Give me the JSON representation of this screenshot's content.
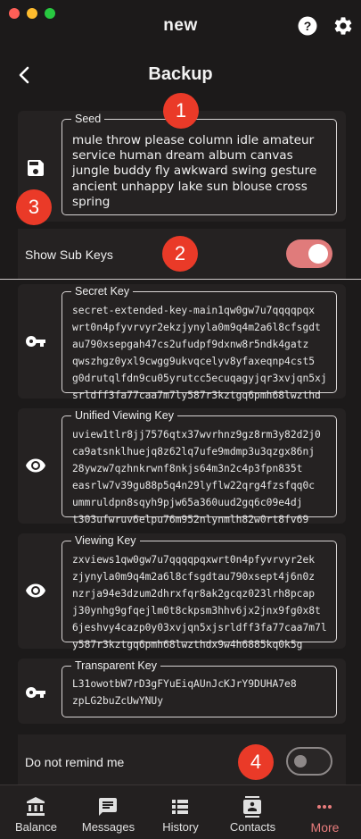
{
  "window": {
    "title": "new"
  },
  "header": {
    "title": "Backup"
  },
  "seed": {
    "label": "Seed",
    "lines": [
      "mule throw please column idle amateur",
      "service human dream album canvas",
      "jungle buddy fly awkward swing gesture",
      "ancient unhappy lake sun blouse cross",
      "spring"
    ]
  },
  "show_sub_keys": {
    "label": "Show Sub Keys",
    "enabled": true
  },
  "keys": [
    {
      "label": "Secret Key",
      "icon": "key-icon",
      "lines": [
        "secret-extended-key-main1qw0gw7u7qqqqpqx",
        "wrt0n4pfyvrvyr2ekzjynyla0m9q4m2a6l8cfsgdt",
        "au790xsepgah47cs2ufudpf9dxnw8r5ndk4gatz",
        "qwszhgz0yxl9cwgg9ukvqcelyv8yfaxeqnp4cst5",
        "g0drutqlfdn9cu05yrutcc5ecuqagyjqr3xvjqn5xj",
        "srldff3fa77caa7m7ly587r3kztgq6pmh68lwzthd"
      ]
    },
    {
      "label": "Unified Viewing Key",
      "icon": "eye-icon",
      "lines": [
        "uview1tlr8jj7576qtx37wvrhnz9gz8rm3y82d2j0",
        "ca9atsnklhuejq8z62lq7ufe9mdmp3u3qzgx86nj",
        "28ywzw7qzhnkrwnf8nkjs64m3n2c4p3fpn835t",
        "easrlw7v39gu88p5q4n29lyflw22qrg4fzsfqq0c",
        "ummruldpn8sqyh9pjw65a360uud2gq6c09e4dj",
        "t303ufwruv6elpu76m952nlynmlh82w0rt8fv69"
      ]
    },
    {
      "label": "Viewing Key",
      "icon": "eye-icon",
      "lines": [
        "zxviews1qw0gw7u7qqqqpqxwrt0n4pfyvrvyr2ek",
        "zjynyla0m9q4m2a6l8cfsgdtau790xsept4j6n0z",
        "nzrja94e3dzum2dhrxfqr8ak2gcqz023lrh8pcap",
        "j30ynhg9gfqejlm0t8ckpsm3hhv6jx2jnx9fg0x8t",
        "6jeshvy4cazp0y03xvjqn5xjsrldff3fa77caa7m7l",
        "y587r3kztgq6pmh68lwzthdx9w4h6885kq0k5g"
      ]
    },
    {
      "label": "Transparent Key",
      "icon": "key-icon",
      "lines": [
        "L31owotbW7rD3gFYuEiqAUnJcKJrY9DUHA7e8",
        "zpLG2buZcUwYNUy"
      ]
    }
  ],
  "remind": {
    "label": "Do not remind me",
    "enabled": false
  },
  "badges": [
    "1",
    "2",
    "3",
    "4"
  ],
  "nav": [
    {
      "label": "Balance",
      "icon": "bank-icon",
      "active": false
    },
    {
      "label": "Messages",
      "icon": "message-icon",
      "active": false
    },
    {
      "label": "History",
      "icon": "list-icon",
      "active": false
    },
    {
      "label": "Contacts",
      "icon": "contacts-icon",
      "active": false
    },
    {
      "label": "More",
      "icon": "more-dots-icon",
      "active": true
    }
  ],
  "colors": {
    "background": "#1c1a1a",
    "card": "#252222",
    "accent": "#e07b7b",
    "badge": "#ea3a28"
  }
}
